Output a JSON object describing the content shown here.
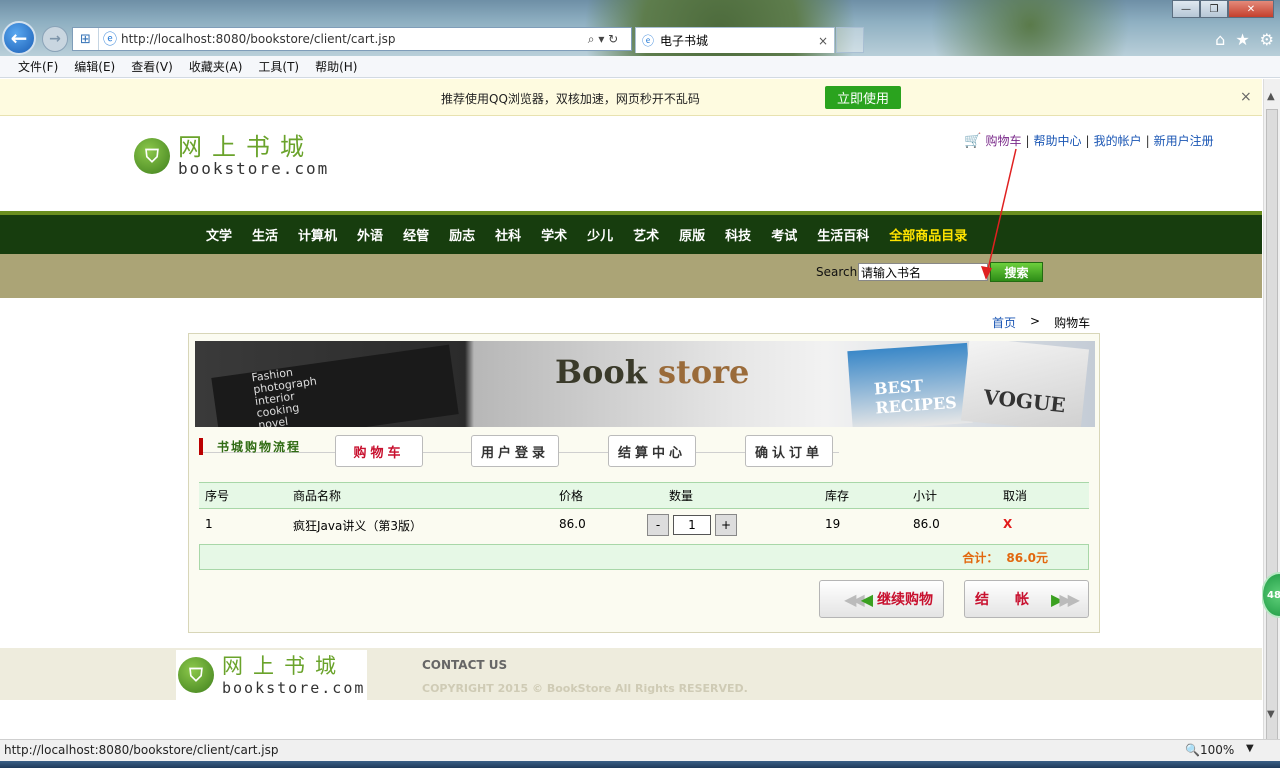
{
  "browser": {
    "url": "http://localhost:8080/bookstore/client/cart.jsp",
    "tab_title": "电子书城",
    "tab_close": "×",
    "addr_icons": "⌕ ▾ ↻",
    "back_glyph": "←",
    "fwd_glyph": "→",
    "win_min": "—",
    "win_max": "❐",
    "win_close": "✕",
    "right_icons": [
      "home-icon",
      "star-icon",
      "gear-icon"
    ],
    "menu": [
      "文件(F)",
      "编辑(E)",
      "查看(V)",
      "收藏夹(A)",
      "工具(T)",
      "帮助(H)"
    ],
    "notify_text": "推荐使用QQ浏览器，双核加速，网页秒开不乱码",
    "notify_button": "立即使用",
    "notify_close": "×",
    "status_url": "http://localhost:8080/bookstore/client/cart.jsp",
    "zoom": "100%",
    "side_widget": "48"
  },
  "site": {
    "logo_cn": "网上书城",
    "logo_en": "bookstore.com",
    "top_links": {
      "cart": "购物车",
      "help": "帮助中心",
      "account": "我的帐户",
      "register": "新用户注册",
      "separator": "|"
    },
    "categories": [
      "文学",
      "生活",
      "计算机",
      "外语",
      "经管",
      "励志",
      "社科",
      "学术",
      "少儿",
      "艺术",
      "原版",
      "科技",
      "考试",
      "生活百科"
    ],
    "all_categories": "全部商品目录",
    "search_label": "Search",
    "search_value": "请输入书名",
    "search_button": "搜索",
    "breadcrumb_home": "首页",
    "breadcrumb_sep": ">",
    "breadcrumb_current": "购物车"
  },
  "banner": {
    "title_a": "Book",
    "title_b": " store",
    "pad_lines": [
      "Fashion",
      "photograph",
      "interior",
      "cooking",
      "novel"
    ],
    "mag1": "BEST RECIPES",
    "mag2": "VOGUE"
  },
  "flow": {
    "label": "书城购物流程",
    "steps": [
      "购物车",
      "用户登录",
      "结算中心",
      "确认订单"
    ]
  },
  "cart": {
    "headers": [
      "序号",
      "商品名称",
      "价格",
      "数量",
      "库存",
      "小计",
      "取消"
    ],
    "rows": [
      {
        "no": "1",
        "name": "疯狂Java讲义（第3版）",
        "price": "86.0",
        "qty": "1",
        "stock": "19",
        "subtotal": "86.0",
        "cancel": "X"
      }
    ],
    "qty_minus": "-",
    "qty_plus": "+",
    "total_label": "合计：",
    "total_value": "86.0元",
    "continue_button": "继续购物",
    "checkout_button": "结　帐"
  },
  "footer": {
    "logo_cn": "网上书城",
    "logo_en": "bookstore.com",
    "contact": "CONTACT US",
    "copyright": "COPYRIGHT 2015 © BookStore All Rights RESERVED."
  },
  "colors": {
    "nav_bg": "#173d0e",
    "search_bg": "#aba476",
    "accent_red": "#c8102e",
    "table_green": "#e6f8e6",
    "total_orange": "#e2670e"
  }
}
